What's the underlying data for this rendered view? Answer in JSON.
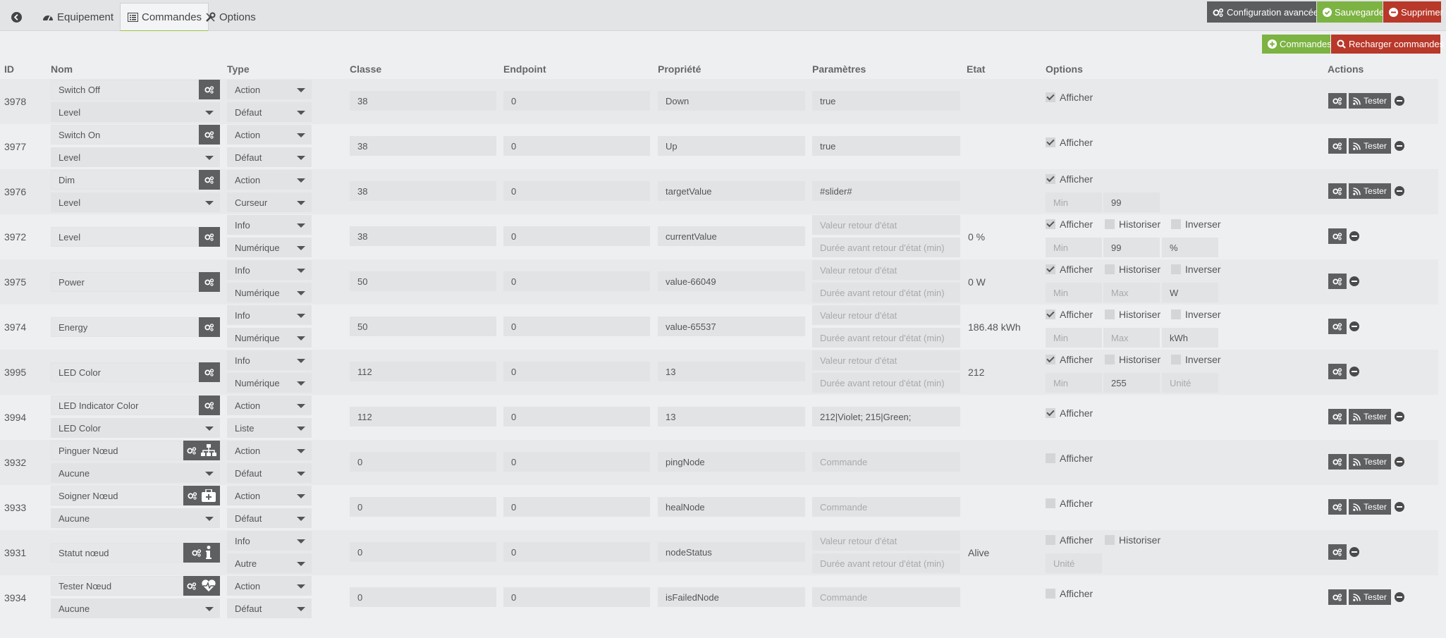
{
  "tabs": {
    "equipement": "Equipement",
    "commandes": "Commandes",
    "options": "Options"
  },
  "toolbar": {
    "config_label": "Configuration avancée",
    "save_label": "Sauvegarder",
    "delete_label": "Supprimer",
    "commands_label": "Commandes",
    "reload_label": "Recharger commandes"
  },
  "headers": {
    "id": "ID",
    "nom": "Nom",
    "type": "Type",
    "classe": "Classe",
    "endpoint": "Endpoint",
    "propriete": "Propriété",
    "parametres": "Paramètres",
    "etat": "Etat",
    "options": "Options",
    "actions": "Actions"
  },
  "labels": {
    "afficher": "Afficher",
    "historiser": "Historiser",
    "inverser": "Inverser",
    "tester": "Tester"
  },
  "placeholders": {
    "valeur_retour": "Valeur retour d'état",
    "duree_retour": "Durée avant retour d'état (min)",
    "commande": "Commande",
    "min": "Min",
    "max": "Max",
    "unite": "Unité"
  },
  "rows": [
    {
      "id": "3978",
      "name": "Switch Off",
      "sub": "Level",
      "type": "Action",
      "subtype": "Défaut",
      "classe": "38",
      "endpoint": "0",
      "prop": "Down",
      "param": "true",
      "etat": "",
      "min": "",
      "max": "",
      "unit": ""
    },
    {
      "id": "3977",
      "name": "Switch On",
      "sub": "Level",
      "type": "Action",
      "subtype": "Défaut",
      "classe": "38",
      "endpoint": "0",
      "prop": "Up",
      "param": "true",
      "etat": "",
      "min": "",
      "max": "",
      "unit": ""
    },
    {
      "id": "3976",
      "name": "Dim",
      "sub": "Level",
      "type": "Action",
      "subtype": "Curseur",
      "classe": "38",
      "endpoint": "0",
      "prop": "targetValue",
      "param": "#slider#",
      "etat": "",
      "min": "",
      "max": "99",
      "unit": ""
    },
    {
      "id": "3972",
      "name": "Level",
      "sub": "",
      "type": "Info",
      "subtype": "Numérique",
      "classe": "38",
      "endpoint": "0",
      "prop": "currentValue",
      "param": "",
      "etat": "0 %",
      "min": "",
      "max": "99",
      "unit": "%"
    },
    {
      "id": "3975",
      "name": "Power",
      "sub": "",
      "type": "Info",
      "subtype": "Numérique",
      "classe": "50",
      "endpoint": "0",
      "prop": "value-66049",
      "param": "",
      "etat": "0 W",
      "min": "",
      "max": "",
      "unit": "W"
    },
    {
      "id": "3974",
      "name": "Energy",
      "sub": "",
      "type": "Info",
      "subtype": "Numérique",
      "classe": "50",
      "endpoint": "0",
      "prop": "value-65537",
      "param": "",
      "etat": "186.48 kWh",
      "min": "",
      "max": "",
      "unit": "kWh"
    },
    {
      "id": "3995",
      "name": "LED Color",
      "sub": "",
      "type": "Info",
      "subtype": "Numérique",
      "classe": "112",
      "endpoint": "0",
      "prop": "13",
      "param": "",
      "etat": "212",
      "min": "",
      "max": "255",
      "unit": ""
    },
    {
      "id": "3994",
      "name": "LED Indicator Color",
      "sub": "LED Color",
      "type": "Action",
      "subtype": "Liste",
      "classe": "112",
      "endpoint": "0",
      "prop": "13",
      "param": "212|Violet; 215|Green;",
      "etat": "",
      "min": "",
      "max": "",
      "unit": ""
    },
    {
      "id": "3932",
      "name": "Pinguer Nœud",
      "sub": "Aucune",
      "type": "Action",
      "subtype": "Défaut",
      "classe": "0",
      "endpoint": "0",
      "prop": "pingNode",
      "param": "",
      "etat": "",
      "min": "",
      "max": "",
      "unit": ""
    },
    {
      "id": "3933",
      "name": "Soigner Nœud",
      "sub": "Aucune",
      "type": "Action",
      "subtype": "Défaut",
      "classe": "0",
      "endpoint": "0",
      "prop": "healNode",
      "param": "",
      "etat": "",
      "min": "",
      "max": "",
      "unit": ""
    },
    {
      "id": "3931",
      "name": "Statut nœud",
      "sub": "",
      "type": "Info",
      "subtype": "Autre",
      "classe": "0",
      "endpoint": "0",
      "prop": "nodeStatus",
      "param": "",
      "etat": "Alive",
      "min": "",
      "max": "",
      "unit": ""
    },
    {
      "id": "3934",
      "name": "Tester Nœud",
      "sub": "Aucune",
      "type": "Action",
      "subtype": "Défaut",
      "classe": "0",
      "endpoint": "0",
      "prop": "isFailedNode",
      "param": "",
      "etat": "",
      "min": "",
      "max": "",
      "unit": ""
    }
  ]
}
